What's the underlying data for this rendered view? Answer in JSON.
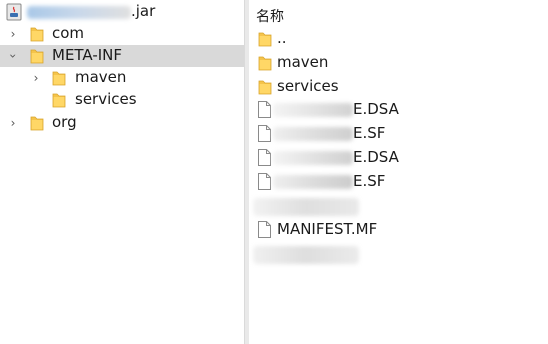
{
  "tree": {
    "root_label": ".jar",
    "items": [
      {
        "label": "com",
        "expanded": false
      },
      {
        "label": "META-INF",
        "expanded": true,
        "selected": true
      },
      {
        "label": "maven",
        "expanded": false
      },
      {
        "label": "services",
        "expanded": null
      },
      {
        "label": "org",
        "expanded": false
      }
    ]
  },
  "list": {
    "header": "名称",
    "entries": [
      {
        "name": "..",
        "type": "folder"
      },
      {
        "name": "maven",
        "type": "folder"
      },
      {
        "name": "services",
        "type": "folder"
      },
      {
        "name": "E.DSA",
        "type": "file"
      },
      {
        "name": "E.SF",
        "type": "file"
      },
      {
        "name": "E.DSA",
        "type": "file"
      },
      {
        "name": "E.SF",
        "type": "file"
      },
      {
        "name": "",
        "type": "file"
      },
      {
        "name": "MANIFEST.MF",
        "type": "file"
      },
      {
        "name": "",
        "type": "file"
      }
    ]
  },
  "icons": {
    "folder": "folder-icon",
    "file": "file-icon",
    "expand": "chevron-right-icon",
    "collapse": "chevron-down-icon",
    "archive": "java-archive-icon"
  },
  "colors": {
    "folder": "#f2c14e",
    "selection": "#d9d9d9"
  }
}
